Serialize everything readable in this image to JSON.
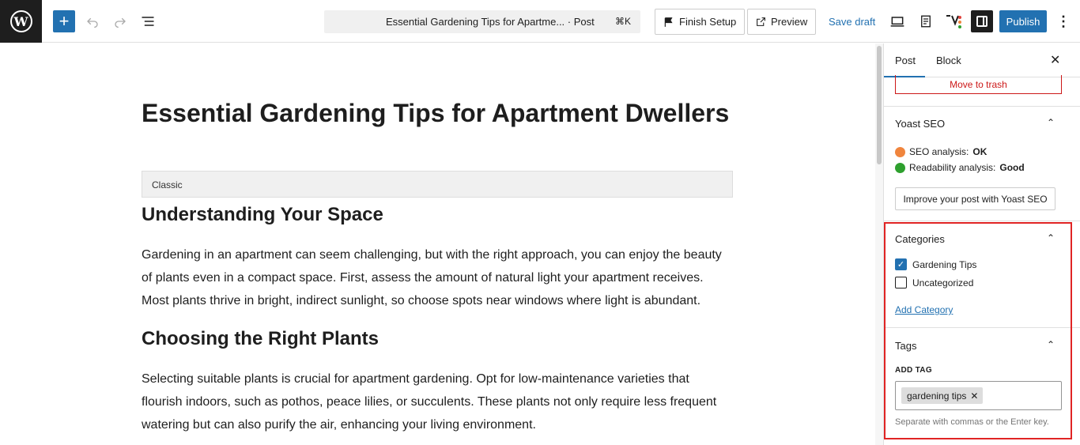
{
  "topbar": {
    "doc_title": "Essential Gardening Tips for Apartme... · Post",
    "shortcut": "⌘K",
    "finish_setup": "Finish Setup",
    "preview": "Preview",
    "save_draft": "Save draft",
    "publish": "Publish"
  },
  "editor": {
    "title": "Essential Gardening Tips for Apartment Dwellers",
    "classic_label": "Classic",
    "heading1": "Understanding Your Space",
    "para1": "Gardening in an apartment can seem challenging, but with the right approach, you can enjoy the beauty of plants even in a compact space. First, assess the amount of natural light your apartment receives. Most plants thrive in bright, indirect sunlight, so choose spots near windows where light is abundant.",
    "heading2": "Choosing the Right Plants",
    "para2": "Selecting suitable plants is crucial for apartment gardening. Opt for low-maintenance varieties that flourish indoors, such as pothos, peace lilies, or succulents. These plants not only require less frequent watering but can also purify the air, enhancing your living environment."
  },
  "sidebar": {
    "tab_post": "Post",
    "tab_block": "Block",
    "move_to_trash": "Move to trash",
    "yoast": {
      "title": "Yoast SEO",
      "seo_label": "SEO analysis:",
      "seo_value": "OK",
      "readability_label": "Readability analysis:",
      "readability_value": "Good",
      "improve_button": "Improve your post with Yoast SEO"
    },
    "categories": {
      "title": "Categories",
      "items": [
        {
          "label": "Gardening Tips",
          "checked": true
        },
        {
          "label": "Uncategorized",
          "checked": false
        }
      ],
      "add_category": "Add Category"
    },
    "tags": {
      "title": "Tags",
      "add_tag_label": "ADD TAG",
      "tag": "gardening tips",
      "help": "Separate with commas or the Enter key."
    }
  },
  "colors": {
    "accent": "#2271b1",
    "danger": "#cc1818",
    "seo_ok": "#f0853d",
    "readability_good": "#2ea02e",
    "highlight": "#e02424"
  }
}
